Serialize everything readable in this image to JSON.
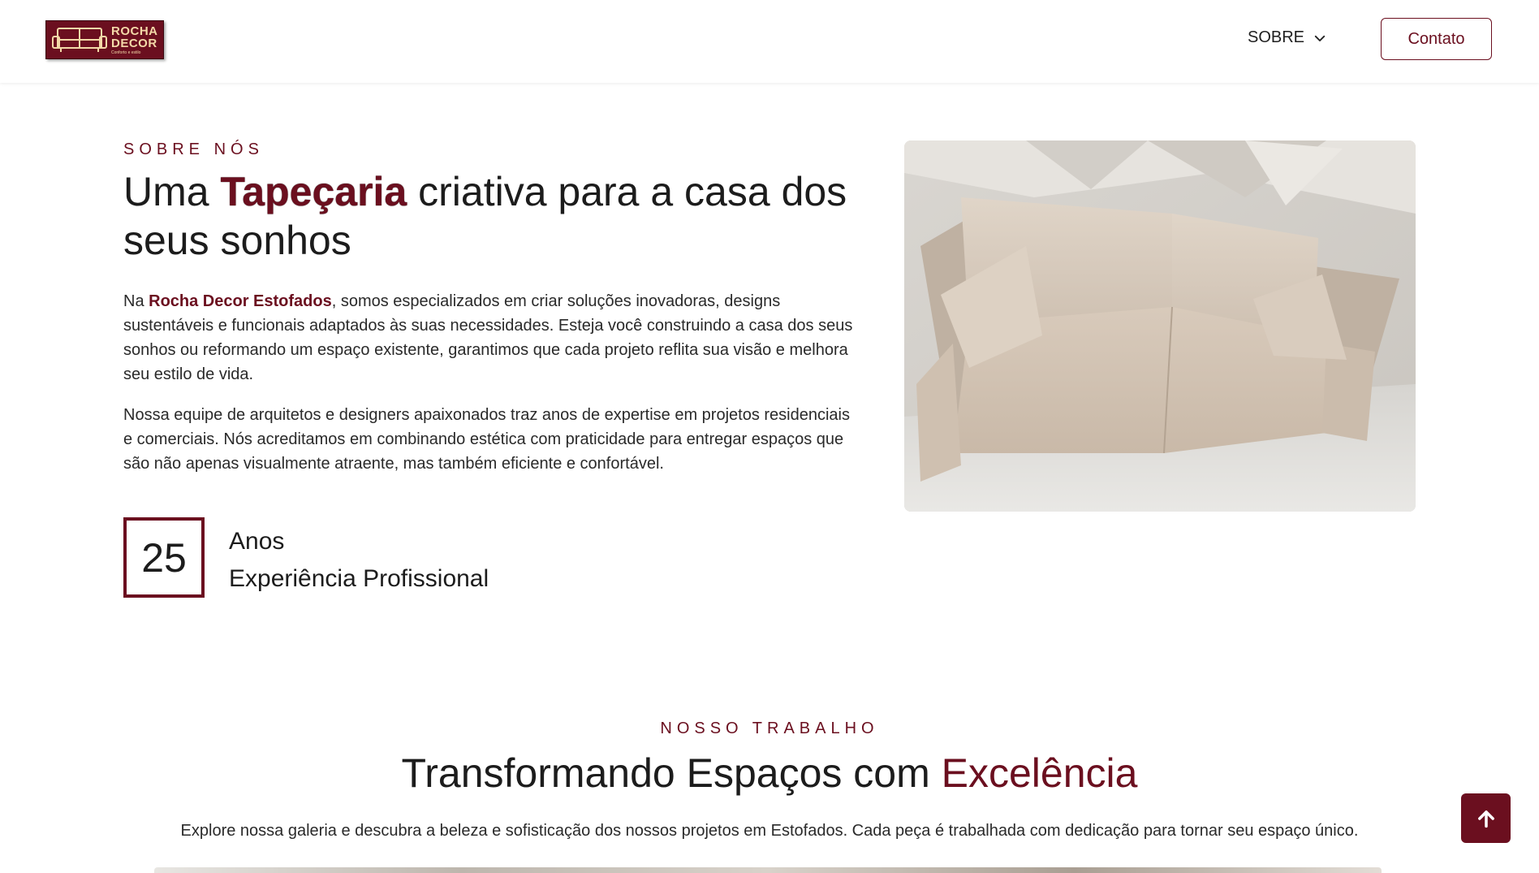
{
  "header": {
    "logo": {
      "line1": "ROCHA",
      "line2": "DECOR",
      "tagline": "Conforto e estilo"
    },
    "nav": {
      "sobre_label": "SOBRE"
    },
    "contato_label": "Contato"
  },
  "about": {
    "eyebrow": "SOBRE NÓS",
    "title_pre": "Uma ",
    "title_highlight": "Tapeçaria",
    "title_post": " criativa para a casa dos seus sonhos",
    "para1_pre": "Na ",
    "para1_brand": "Rocha Decor Estofados",
    "para1_post": ", somos especializados em criar soluções inovadoras, designs sustentáveis e funcionais adaptados às suas necessidades. Esteja você construindo a casa dos seus sonhos ou reformando um espaço existente, garantimos que cada projeto reflita sua visão e melhora seu estilo de vida.",
    "para2": "Nossa equipe de arquitetos e designers apaixonados traz anos de expertise em projetos residenciais e comerciais. Nós acreditamos em combinando estética com praticidade para entregar espaços que são não apenas visualmente atraente, mas também eficiente e confortável.",
    "years_value": "25",
    "years_label1": "Anos",
    "years_label2": "Experiência Profissional"
  },
  "work": {
    "eyebrow": "NOSSO TRABALHO",
    "title_pre": "Transformando Espaços com ",
    "title_highlight": "Excelência",
    "description": "Explore nossa galeria e descubra a beleza e sofisticação dos nossos projetos em Estofados. Cada peça é trabalhada com dedicação para tornar seu espaço único."
  },
  "colors": {
    "brand": "#6b0f1f",
    "text": "#1c1c1c",
    "logo_text": "#f3d9a8"
  },
  "icons": {
    "logo": "sofa-icon",
    "nav_dropdown": "chevron-down-icon",
    "back_to_top": "arrow-up-icon"
  }
}
